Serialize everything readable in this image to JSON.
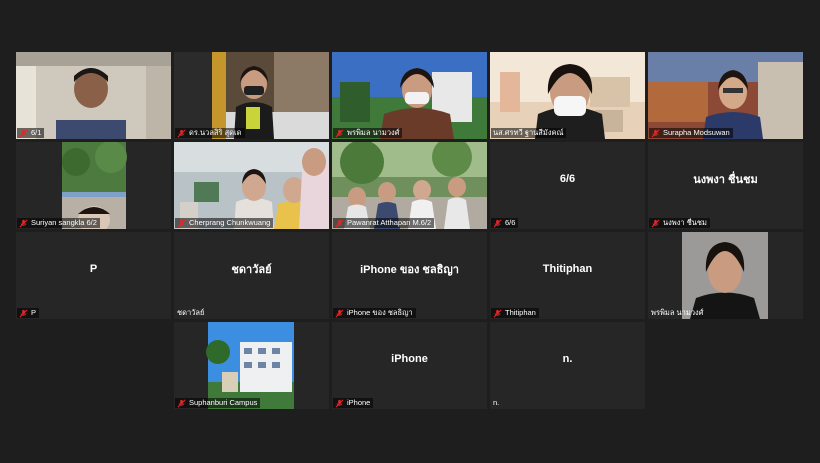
{
  "participants": [
    {
      "name": "6/1",
      "muted": true
    },
    {
      "name": "ดร.นวลสิริ สุดเด",
      "muted": true
    },
    {
      "name": "พรพิมล นามวงศ์",
      "muted": true
    },
    {
      "name": "นส.ศรทวี ฐานสีมังคณ์",
      "muted": false
    },
    {
      "name": "Surapha Modsuwan",
      "muted": true
    },
    {
      "name": "Suriyan sangkla 6/2",
      "muted": true
    },
    {
      "name": "Cherprang Chunkwuang",
      "muted": true
    },
    {
      "name": "Pawanrat Atthapan M.6/2",
      "muted": true
    },
    {
      "name": "6/6",
      "center": "6/6",
      "muted": true
    },
    {
      "name": "นงพงา ชื่นชม",
      "center": "นงพงา ชื่นชม",
      "muted": true
    },
    {
      "name": "P",
      "center": "P",
      "muted": true
    },
    {
      "name": "ชดาวัลย์",
      "center": "ชดาวัลย์",
      "muted": false
    },
    {
      "name": "iPhone ของ ชลธิญา",
      "center": "iPhone ของ ชลธิญา",
      "muted": true
    },
    {
      "name": "Thitiphan",
      "center": "Thitiphan",
      "muted": true
    },
    {
      "name": "พรพิมล นามวงศ์",
      "muted": false
    },
    {
      "name": "Suphanburi Campus",
      "muted": true
    },
    {
      "name": "iPhone",
      "center": "iPhone",
      "muted": true
    },
    {
      "name": "n.",
      "center": "n.",
      "muted": false
    }
  ],
  "colors": {
    "active_speaker": "#e3e33a",
    "mic_off": "#e02828",
    "tile": "#262626",
    "background": "#1e1e1e"
  }
}
